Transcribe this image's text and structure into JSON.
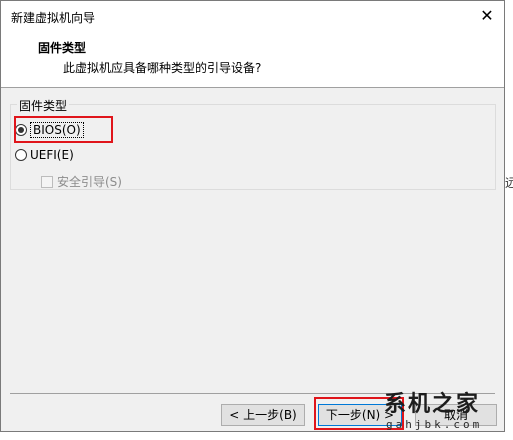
{
  "window": {
    "title": "新建虚拟机向导",
    "close_glyph": "✕"
  },
  "header": {
    "title": "固件类型",
    "subtitle": "此虚拟机应具备哪种类型的引导设备?"
  },
  "firmware_group": {
    "legend": "固件类型",
    "options": [
      {
        "label": "BIOS(O)",
        "selected": true
      },
      {
        "label": "UEFI(E)",
        "selected": false
      }
    ],
    "secure_boot": {
      "label": "安全引导(S)",
      "checked": false,
      "disabled": true
    }
  },
  "buttons": {
    "back": "< 上一步(B)",
    "next": "下一步(N) >",
    "cancel": "取消"
  },
  "watermark": {
    "main": "系机之家",
    "sub": "gahjbk.com"
  },
  "right_edge_text": "远",
  "colors": {
    "highlight": "#e0151b",
    "focus_border": "#0078d7"
  }
}
